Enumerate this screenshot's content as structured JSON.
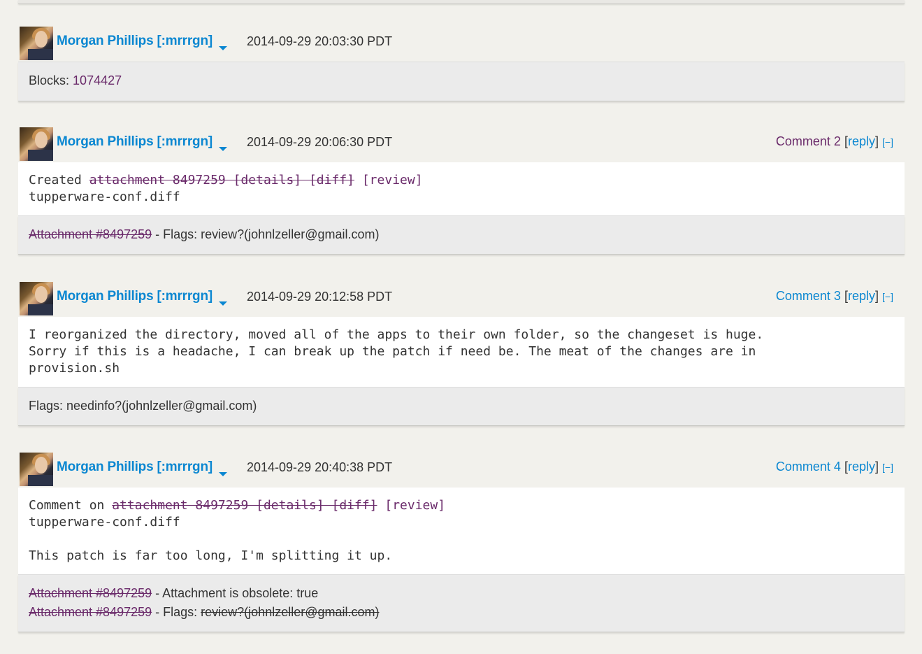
{
  "changes": [
    {
      "user": "Morgan Phillips [:mrrrgn]",
      "date": "2014-09-29 20:03:30 PDT",
      "meta_label": "Blocks:",
      "meta_link": "1074427"
    },
    {
      "user": "Morgan Phillips [:mrrrgn]",
      "date": "2014-09-29 20:06:30 PDT",
      "comment_num": "Comment 2",
      "reply_open": "[",
      "reply": "reply",
      "reply_close": "]",
      "collapse": "[−]",
      "body_prefix": "Created ",
      "body_attachment": "attachment 8497259 [details] [diff]",
      "body_review": "[review]",
      "body_line2": "tupperware-conf.diff",
      "meta_attachment": "Attachment #8497259",
      "meta_text": " - Flags: review?(johnlzeller@gmail.com)"
    },
    {
      "user": "Morgan Phillips [:mrrrgn]",
      "date": "2014-09-29 20:12:58 PDT",
      "comment_num": "Comment 3",
      "reply_open": "[",
      "reply": "reply",
      "reply_close": "]",
      "collapse": "[−]",
      "body_text": "I reorganized the directory, moved all of the apps to their own folder, so the changeset is huge.\nSorry if this is a headache, I can break up the patch if need be. The meat of the changes are in\nprovision.sh",
      "meta_text": "Flags: needinfo?(johnlzeller@gmail.com)"
    },
    {
      "user": "Morgan Phillips [:mrrrgn]",
      "date": "2014-09-29 20:40:38 PDT",
      "comment_num": "Comment 4",
      "reply_open": "[",
      "reply": "reply",
      "reply_close": "]",
      "collapse": "[−]",
      "body_prefix": "Comment on ",
      "body_attachment": "attachment 8497259 [details] [diff]",
      "body_review": "[review]",
      "body_line2": "tupperware-conf.diff",
      "body_line4": "This patch is far too long, I'm splitting it up.",
      "meta1_attachment": "Attachment #8497259",
      "meta1_text": " - Attachment is obsolete: true",
      "meta2_attachment": "Attachment #8497259",
      "meta2_text": " - Flags: ",
      "meta2_struck": "review?(johnlzeller@gmail.com)"
    }
  ]
}
